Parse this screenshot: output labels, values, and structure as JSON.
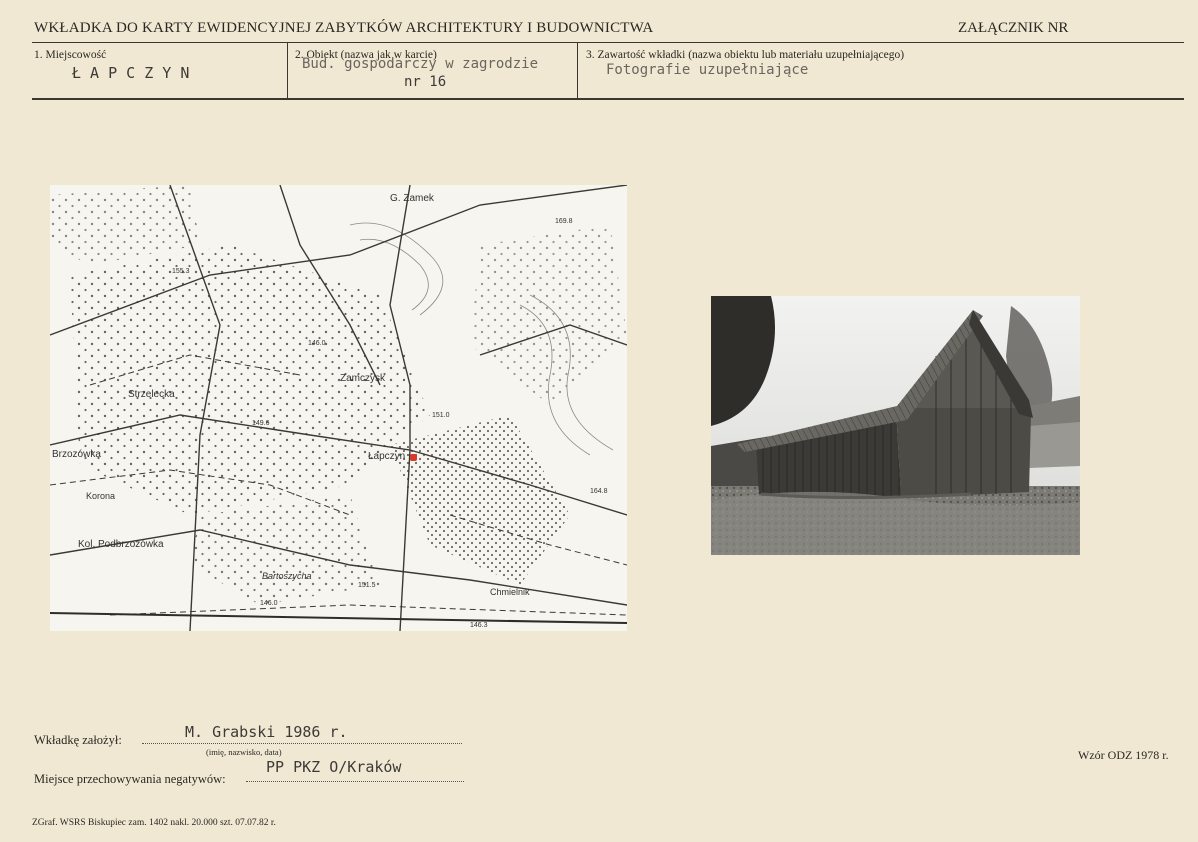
{
  "header": {
    "title": "WKŁADKA DO KARTY EWIDENCYJNEJ ZABYTKÓW ARCHITEKTURY I BUDOWNICTWA",
    "annex": "ZAŁĄCZNIK NR"
  },
  "fields": {
    "location_label": "1. Miejscowość",
    "location_value": "Ł A P C Z Y N",
    "object_label": "2. Obiekt (nazwa jak w karcie)",
    "object_value_line1": "Bud. gospodarczy w zagrodzie",
    "object_value_line2": "nr 16",
    "content_label": "3. Zawartość wkładki (nazwa obiektu lub materiału uzupełniającego)",
    "content_value": "Fotografie uzupełniające"
  },
  "map": {
    "labels": [
      "G. Zamek",
      "Strzelecka",
      "Zamczysk",
      "Łapczyn",
      "Brzozówka",
      "Korona",
      "Kol. Podbrzozówka",
      "Bartoszycha",
      "Chmielnik"
    ],
    "elevations": [
      "155.3",
      "169.8",
      "146.0",
      "151.0",
      "149.6",
      "164.8",
      "151.5",
      "146.0",
      "146.3"
    ]
  },
  "footer": {
    "founded_label": "Wkładkę założył:",
    "founded_value": "M. Grabski 1986 r.",
    "founded_hint": "(imię, nazwisko, data)",
    "negatives_label": "Miejsce przechowywania negatywów:",
    "negatives_value": "PP PKZ O/Kraków",
    "form_note": "Wzór ODZ 1978 r.",
    "printer": "ZGraf. WSRS Biskupiec zam. 1402 nakl. 20.000 szt. 07.07.82 r."
  },
  "colors": {
    "paper": "#f1e8d4",
    "ink": "#2a2722",
    "marker": "#d83a2a"
  }
}
